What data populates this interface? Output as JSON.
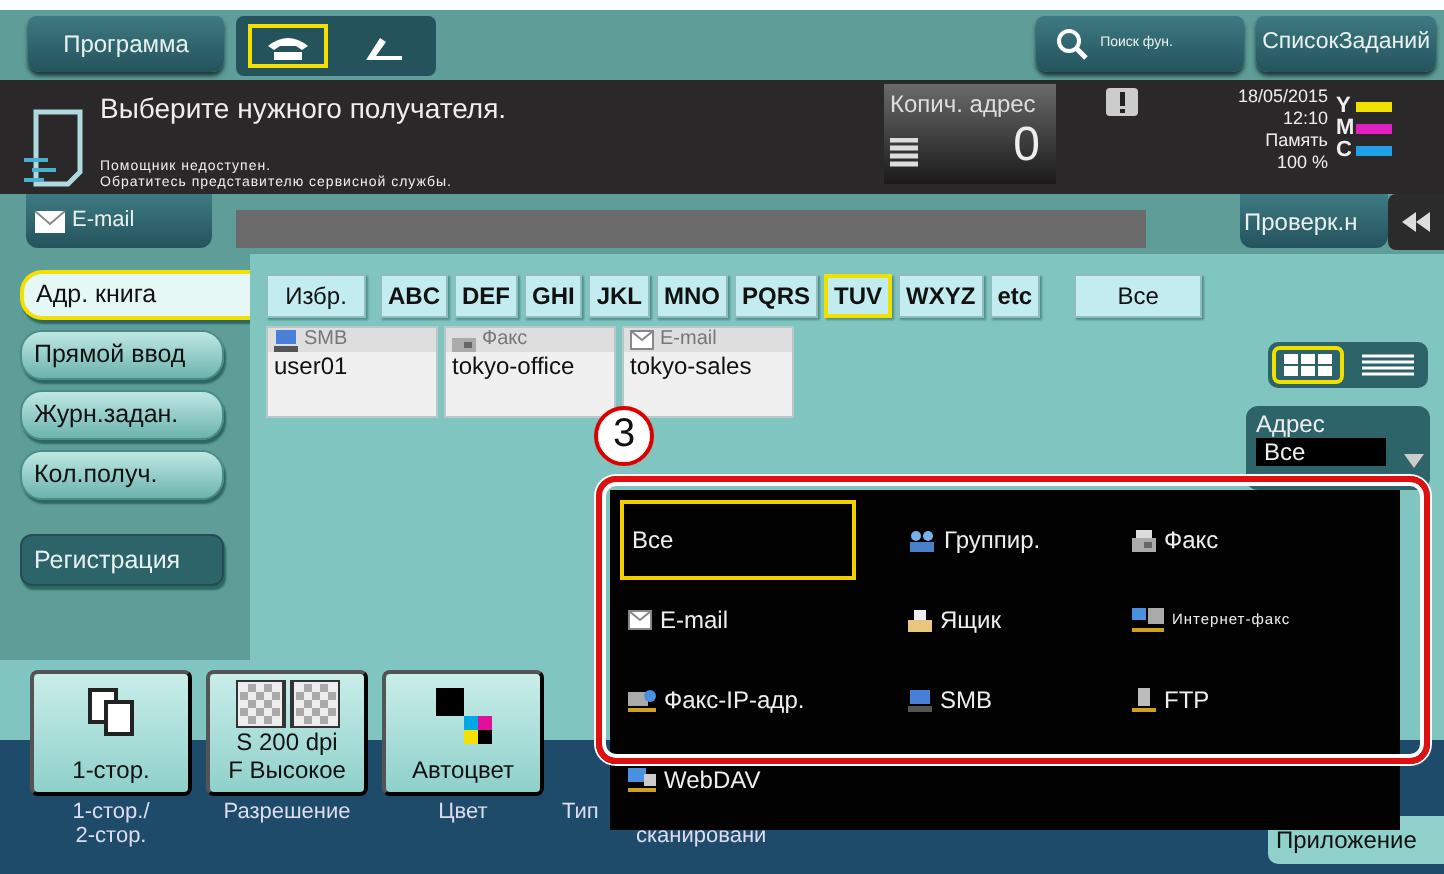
{
  "top_bar": {
    "program_button": "Программа",
    "modes": [
      {
        "kind": "phone",
        "selected": true
      },
      {
        "kind": "handset",
        "selected": false
      }
    ],
    "search_button": "Поиск фун.",
    "jobs_button": "СписокЗаданий"
  },
  "message": {
    "title": "Выберите нужного получателя.",
    "notes": [
      "Помощник недоступен.",
      "Обратитесь представителю сервисной службы."
    ]
  },
  "counter": {
    "label": "Копич. адрес",
    "value": "0"
  },
  "status": {
    "date": "18/05/2015",
    "time": "12:10",
    "memory_label": "Память",
    "memory_value": "100 %",
    "toners": [
      {
        "label": "Y",
        "color": "#f0e000"
      },
      {
        "label": "M",
        "color": "#e020c0"
      },
      {
        "label": "C",
        "color": "#20a0e8"
      }
    ]
  },
  "mode_tab": "E-mail",
  "check_button": "Проверк.н",
  "side_buttons": [
    {
      "label": "Адр. книга",
      "kind": "tab",
      "selected": true
    },
    {
      "label": "Прямой ввод",
      "kind": "tab",
      "selected": false
    },
    {
      "label": "Журн.задан.",
      "kind": "tab",
      "selected": false
    },
    {
      "label": "Кол.получ.",
      "kind": "tab",
      "selected": false
    },
    {
      "label": "Регистрация",
      "kind": "action",
      "selected": false
    }
  ],
  "index_tabs": [
    {
      "label": "Избр.",
      "kind": "wide",
      "selected": false
    },
    {
      "label": "ABC",
      "kind": "letter",
      "selected": false
    },
    {
      "label": "DEF",
      "kind": "letter",
      "selected": false
    },
    {
      "label": "GHI",
      "kind": "letter",
      "selected": false
    },
    {
      "label": "JKL",
      "kind": "letter",
      "selected": false
    },
    {
      "label": "MNO",
      "kind": "letter",
      "selected": false
    },
    {
      "label": "PQRS",
      "kind": "letter",
      "selected": false
    },
    {
      "label": "TUV",
      "kind": "letter",
      "selected": true
    },
    {
      "label": "WXYZ",
      "kind": "letter",
      "selected": false
    },
    {
      "label": "etc",
      "kind": "letter",
      "selected": false
    },
    {
      "label": "Все",
      "kind": "wide",
      "selected": false
    }
  ],
  "entries": [
    {
      "kind": "smb",
      "type": "SMB",
      "name": "user01"
    },
    {
      "kind": "fax",
      "type": "Факс",
      "name": "tokyo-office"
    },
    {
      "kind": "email",
      "type": "E-mail",
      "name": "tokyo-sales"
    }
  ],
  "view_modes": [
    {
      "kind": "grid",
      "selected": true
    },
    {
      "kind": "list",
      "selected": false
    }
  ],
  "address_filter": {
    "label": "Адрес",
    "value": "Все"
  },
  "callout": "3",
  "filter_menu": {
    "items": [
      {
        "kind": "all",
        "label": "Все",
        "selected": true
      },
      {
        "kind": "group",
        "label": "Группир.",
        "selected": false
      },
      {
        "kind": "fax",
        "label": "Факс",
        "selected": false
      },
      {
        "kind": "email",
        "label": "E-mail",
        "selected": false
      },
      {
        "kind": "box",
        "label": "Ящик",
        "selected": false
      },
      {
        "kind": "ifax",
        "label": "Интернет-факс",
        "selected": false
      },
      {
        "kind": "ipfax",
        "label": "Факс-IP-адр.",
        "selected": false
      },
      {
        "kind": "smb",
        "label": "SMB",
        "selected": false
      },
      {
        "kind": "ftp",
        "label": "FTP",
        "selected": false
      },
      {
        "kind": "webdav",
        "label": "WebDAV",
        "selected": false
      }
    ]
  },
  "settings": [
    {
      "kind": "duplex",
      "value": [
        "1-стор."
      ],
      "caption": [
        "1-стор./",
        "2-стор."
      ]
    },
    {
      "kind": "resolution",
      "value": [
        "S 200 dpi",
        "F Высокое"
      ],
      "caption": [
        "Разрешение"
      ]
    },
    {
      "kind": "color",
      "value": [
        "Автоцвет"
      ],
      "caption": [
        "Цвет"
      ]
    },
    {
      "kind": "blank",
      "caption": [
        "Тип",
        "сканировани"
      ]
    }
  ],
  "app_button": "Приложение"
}
